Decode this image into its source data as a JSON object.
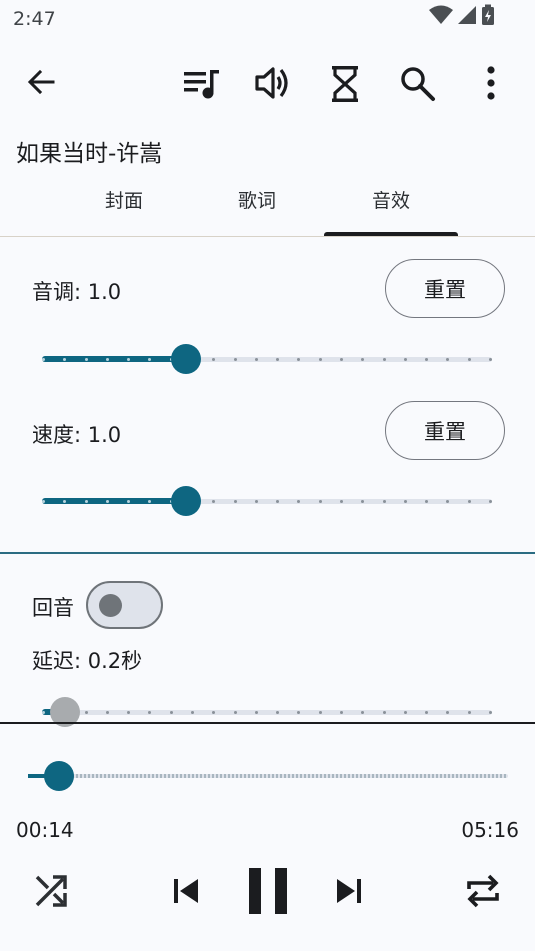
{
  "status_bar": {
    "time": "2:47",
    "icons": [
      "wifi-icon",
      "signal-icon",
      "battery-charging-icon"
    ]
  },
  "app_bar": {
    "icons": [
      "back-arrow-icon",
      "playlist-icon",
      "volume-icon",
      "timer-icon",
      "search-icon",
      "more-vert-icon"
    ]
  },
  "song": {
    "title": "如果当时-许嵩"
  },
  "tabs": [
    {
      "label": "封面",
      "selected": false
    },
    {
      "label": "歌词",
      "selected": false
    },
    {
      "label": "音效",
      "selected": true
    }
  ],
  "effects": {
    "pitch": {
      "label": "音调: 1.0",
      "reset_label": "重置",
      "value": 1.0,
      "fraction": 0.32
    },
    "speed": {
      "label": "速度: 1.0",
      "reset_label": "重置",
      "value": 1.0,
      "fraction": 0.32
    },
    "echo": {
      "label": "回音",
      "enabled": false
    },
    "delay": {
      "label": "延迟: 0.2秒",
      "fraction": 0.05
    }
  },
  "player": {
    "current_time": "00:14",
    "total_time": "05:16",
    "progress_fraction": 0.044,
    "controls": [
      "shuffle-icon",
      "skip-previous-icon",
      "pause-icon",
      "skip-next-icon",
      "repeat-icon"
    ]
  },
  "colors": {
    "accent": "#0e6681",
    "background": "#f9fafd",
    "text": "#1b1c1f"
  }
}
